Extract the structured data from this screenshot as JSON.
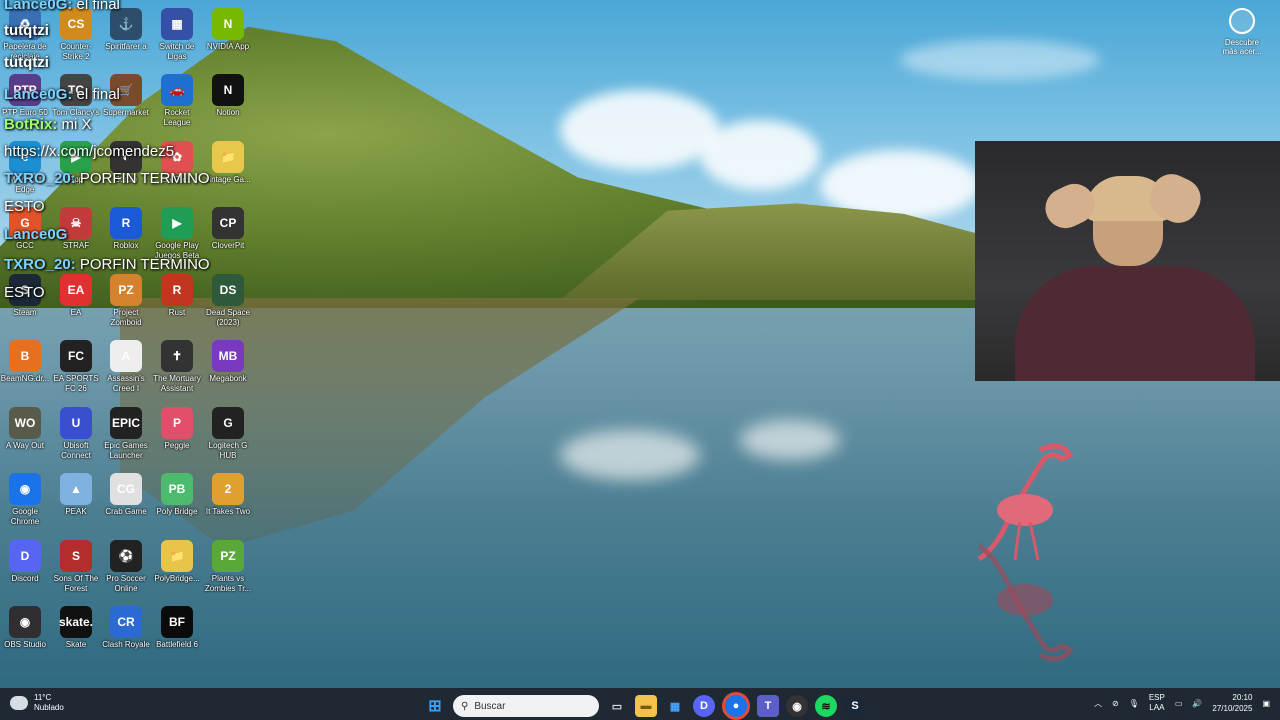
{
  "desktop_icons": [
    {
      "label": "Papelera de reciclaje",
      "color": "#3b6fb3"
    },
    {
      "label": "Counter-Strike 2",
      "color": "#d08a1e"
    },
    {
      "label": "Spiritfarer a",
      "color": "#2d4d6a"
    },
    {
      "label": "Switch de Ligas",
      "color": "#3650a8"
    },
    {
      "label": "NVIDIA App",
      "color": "#76b900"
    },
    {
      "label": "PTP Euro 50",
      "color": "#5a3d8a"
    },
    {
      "label": "Tom Clancy's",
      "color": "#444444"
    },
    {
      "label": "Supermarket",
      "color": "#7a4a2d"
    },
    {
      "label": "Rocket League",
      "color": "#1f6fd1"
    },
    {
      "label": "Notion",
      "color": "#111111"
    },
    {
      "label": "Microsoft Edge",
      "color": "#1c8fd3"
    },
    {
      "label": "App",
      "color": "#2aa04a"
    },
    {
      "label": "Studio",
      "color": "#333333"
    },
    {
      "label": "La Ga...",
      "color": "#e05050"
    },
    {
      "label": "vintage Ga...",
      "color": "#e8c84a"
    },
    {
      "label": "GCC",
      "color": "#e0542a"
    },
    {
      "label": "STRAF",
      "color": "#c33a3a"
    },
    {
      "label": "Roblox",
      "color": "#1a5ad8"
    },
    {
      "label": "Google Play Juegos Beta",
      "color": "#1f9d55"
    },
    {
      "label": "CloverPit",
      "color": "#333333"
    },
    {
      "label": "Steam",
      "color": "#1b2838"
    },
    {
      "label": "EA",
      "color": "#e03030"
    },
    {
      "label": "Project Zomboid",
      "color": "#d5822d"
    },
    {
      "label": "Rust",
      "color": "#c2351f"
    },
    {
      "label": "Dead Space (2023)",
      "color": "#2e5a3b"
    },
    {
      "label": "BeamNG.dr...",
      "color": "#e6701e"
    },
    {
      "label": "EA SPORTS FC 26",
      "color": "#222222"
    },
    {
      "label": "Assassin's Creed I",
      "color": "#eeeeee"
    },
    {
      "label": "The Mortuary Assistant",
      "color": "#333333"
    },
    {
      "label": "Megabonk",
      "color": "#7a3ac0"
    },
    {
      "label": "A Way Out",
      "color": "#5a5a4a"
    },
    {
      "label": "Ubisoft Connect",
      "color": "#3a4fd0"
    },
    {
      "label": "Epic Games Launcher",
      "color": "#222222"
    },
    {
      "label": "Peggle",
      "color": "#e24f6b"
    },
    {
      "label": "Logitech G HUB",
      "color": "#222222"
    },
    {
      "label": "Google Chrome",
      "color": "#1a73e8"
    },
    {
      "label": "PEAK",
      "color": "#7fb2e0"
    },
    {
      "label": "Crab Game",
      "color": "#e0e0e0"
    },
    {
      "label": "Poly Bridge",
      "color": "#4dbb6e"
    },
    {
      "label": "It Takes Two",
      "color": "#e0a030"
    },
    {
      "label": "Discord",
      "color": "#5865f2"
    },
    {
      "label": "Sons Of The Forest",
      "color": "#b52c2c"
    },
    {
      "label": "Pro Soccer Online",
      "color": "#222222"
    },
    {
      "label": "PolyBridge...",
      "color": "#e8c44a"
    },
    {
      "label": "Plants vs Zombies Tr...",
      "color": "#5aa83a"
    },
    {
      "label": "OBS Studio",
      "color": "#302e31"
    },
    {
      "label": "Skate",
      "color": "#111111"
    },
    {
      "label": "Clash Royale",
      "color": "#2b6ad0"
    },
    {
      "label": "Battlefield 6",
      "color": "#0b0b0b"
    }
  ],
  "icon_glyphs": [
    "♻",
    "CS",
    "⚓",
    "▦",
    "N",
    "PTP",
    "TC",
    "🛒",
    "🚗",
    "N",
    "e",
    "▶",
    "◐",
    "✿",
    "📁",
    "G",
    "☠",
    "R",
    "▶",
    "CP",
    "S",
    "EA",
    "PZ",
    "R",
    "DS",
    "B",
    "FC",
    "A",
    "✝",
    "MB",
    "WO",
    "U",
    "EPIC",
    "P",
    "G",
    "◉",
    "▲",
    "CG",
    "PB",
    "2",
    "D",
    "S",
    "⚽",
    "📁",
    "PZ",
    "◉",
    "skate.",
    "CR",
    "BF"
  ],
  "chat": [
    {
      "user": "Lance0G:",
      "msg": " el final"
    },
    {
      "user": "tutqtzi",
      "msg": ""
    },
    {
      "user": "tutqtzi",
      "msg": ""
    },
    {
      "user": "Lance0G:",
      "msg": " el final"
    },
    {
      "user": "BotRix:",
      "msg": " mi X"
    },
    {
      "user": "",
      "msg": "https://x.com/jcomendez5"
    },
    {
      "user": "TXRO_20:",
      "msg": " PORFIN TERMINO"
    },
    {
      "user": "",
      "msg": "ESTO"
    },
    {
      "user": "Lance0G",
      "msg": ""
    },
    {
      "user": "TXRO_20:",
      "msg": " PORFIN TERMINO"
    },
    {
      "user": "",
      "msg": "ESTO"
    }
  ],
  "learn_more": {
    "label": "Descubre más acer..."
  },
  "taskbar": {
    "weather_temp": "11°C",
    "weather_desc": "Nublado",
    "search_placeholder": "Buscar",
    "language_top": "ESP",
    "language_bottom": "LAA",
    "time": "20:10",
    "date": "27/10/2025",
    "apps": [
      "file-explorer",
      "microsoft-store",
      "discord",
      "chrome",
      "teams",
      "github",
      "spotify",
      "steam"
    ]
  }
}
